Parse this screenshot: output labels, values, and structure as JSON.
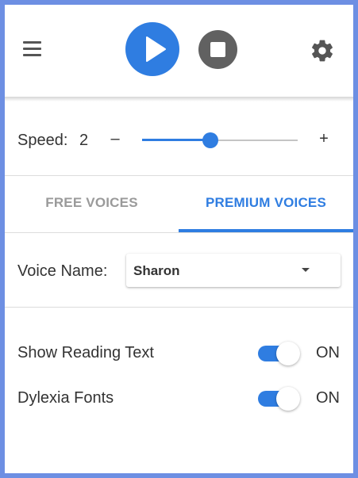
{
  "toolbar": {
    "menu_icon": "hamburger-menu-icon",
    "play_icon": "play-icon",
    "stop_icon": "stop-icon",
    "settings_icon": "gear-icon",
    "accent": "#2f7de1",
    "stop_color": "#616161"
  },
  "speed": {
    "label": "Speed:",
    "value": "2",
    "minus": "–",
    "plus": "+",
    "slider_fraction": 0.44
  },
  "tabs": [
    {
      "label": "FREE VOICES",
      "active": false
    },
    {
      "label": "PREMIUM VOICES",
      "active": true
    }
  ],
  "voice": {
    "label": "Voice Name:",
    "selected": "Sharon"
  },
  "options": [
    {
      "label": "Show Reading Text",
      "state": "ON",
      "enabled": true
    },
    {
      "label": "Dylexia Fonts",
      "state": "ON",
      "enabled": true
    }
  ],
  "colors": {
    "frame": "#6d8fe3",
    "accent": "#2f7de1",
    "inactive_tab": "#9a9a9a"
  }
}
